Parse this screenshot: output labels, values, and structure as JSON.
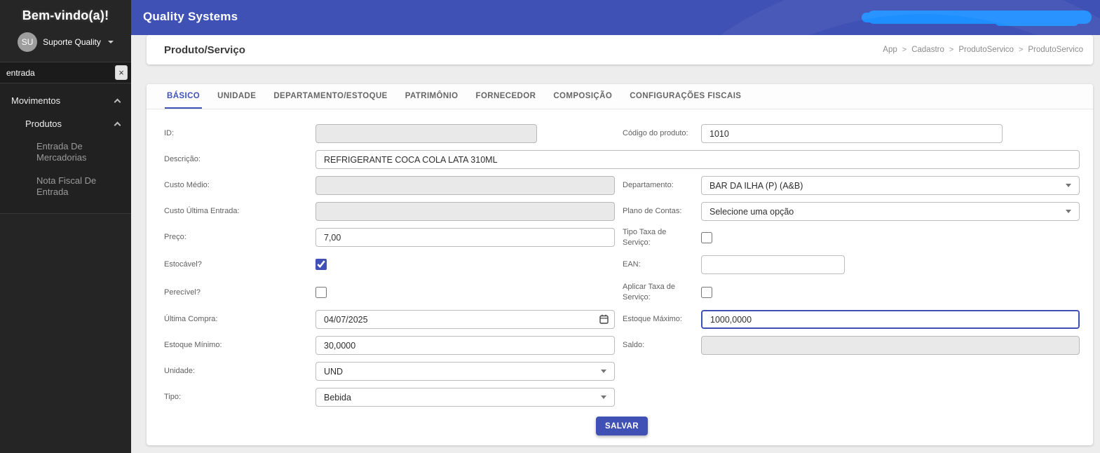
{
  "colors": {
    "accent": "#3f51b5",
    "redaction": "#1e8fff",
    "sidebar_bg": "#262626",
    "topbar_bg": "#3f51b5"
  },
  "sidebar": {
    "welcome": "Bem-vindo(a)!",
    "avatar_initials": "SU",
    "user_name": "Suporte Quality",
    "search_value": "entrada",
    "clear_icon": "×",
    "menu": [
      {
        "label": "Movimentos",
        "level": 1,
        "expanded": true
      },
      {
        "label": "Produtos",
        "level": 2,
        "expanded": true
      },
      {
        "label": "Entrada De Mercadorias",
        "level": 3
      },
      {
        "label": "Nota Fiscal De Entrada",
        "level": 3
      }
    ]
  },
  "topbar": {
    "app_title": "Quality Systems"
  },
  "page": {
    "title": "Produto/Serviço",
    "breadcrumb": [
      "App",
      "Cadastro",
      "ProdutoServico",
      "ProdutoServico"
    ],
    "breadcrumb_separator": ">"
  },
  "tabs": [
    {
      "label": "BÁSICO",
      "active": true
    },
    {
      "label": "UNIDADE",
      "active": false
    },
    {
      "label": "DEPARTAMENTO/ESTOQUE",
      "active": false
    },
    {
      "label": "PATRIMÔNIO",
      "active": false
    },
    {
      "label": "FORNECEDOR",
      "active": false
    },
    {
      "label": "COMPOSIÇÃO",
      "active": false
    },
    {
      "label": "CONFIGURAÇÕES FISCAIS",
      "active": false
    }
  ],
  "form": {
    "id": {
      "label": "ID:",
      "value": "",
      "disabled": true
    },
    "codigo": {
      "label": "Código do produto:",
      "value": "1010"
    },
    "descricao": {
      "label": "Descrição:",
      "value": "REFRIGERANTE COCA COLA LATA 310ML"
    },
    "custo_medio": {
      "label": "Custo Médio:",
      "value": "",
      "disabled": true
    },
    "departamento": {
      "label": "Departamento:",
      "value": "BAR DA ILHA (P) (A&B)"
    },
    "custo_ultima": {
      "label": "Custo Última Entrada:",
      "value": "",
      "disabled": true
    },
    "plano_contas": {
      "label": "Plano de Contas:",
      "value": "Selecione uma opção"
    },
    "preco": {
      "label": "Preço:",
      "value": "7,00"
    },
    "tipo_taxa": {
      "label": "Tipo Taxa de Serviço:",
      "checked": false
    },
    "estocavel": {
      "label": "Estocável?",
      "checked": true
    },
    "ean": {
      "label": "EAN:",
      "value": ""
    },
    "perecivel": {
      "label": "Perecível?",
      "checked": false
    },
    "aplicar_taxa": {
      "label": "Aplicar Taxa de Serviço:",
      "checked": false
    },
    "ultima_compra": {
      "label": "Última Compra:",
      "value": "04/07/2025"
    },
    "estoque_maximo": {
      "label": "Estoque Máximo:",
      "value": "1000,0000",
      "focused": true
    },
    "estoque_minimo": {
      "label": "Estoque Mínimo:",
      "value": "30,0000"
    },
    "saldo": {
      "label": "Saldo:",
      "value": "",
      "disabled": true
    },
    "unidade": {
      "label": "Unidade:",
      "value": "UND"
    },
    "tipo": {
      "label": "Tipo:",
      "value": "Bebida"
    }
  },
  "actions": {
    "save_label": "SALVAR"
  }
}
